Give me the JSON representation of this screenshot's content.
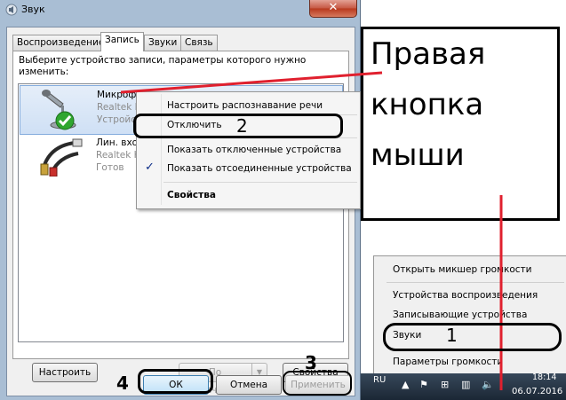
{
  "dialog": {
    "title": "Звук",
    "close_glyph": "✕",
    "tabs": [
      {
        "label": "Воспроизведение",
        "active": false
      },
      {
        "label": "Запись",
        "active": true
      },
      {
        "label": "Звуки",
        "active": false
      },
      {
        "label": "Связь",
        "active": false
      }
    ],
    "instruction": "Выберите устройство записи, параметры которого нужно изменить:",
    "devices": [
      {
        "name": "Микрофон",
        "line2": "Realtek High",
        "line3": "Устройство",
        "icon": "microphone-icon",
        "selected": true
      },
      {
        "name": "Лин. вход",
        "line2": "Realtek High",
        "line3": "Готов",
        "icon": "line-in-jack-icon",
        "selected": false
      }
    ],
    "buttons": {
      "configure": "Настроить",
      "default": "По умолчанию",
      "properties": "Свойства",
      "ok": "ОК",
      "cancel": "Отмена",
      "apply": "Применить"
    }
  },
  "context_menu": {
    "items": [
      {
        "label": "Настроить распознавание речи"
      },
      {
        "label": "Отключить"
      },
      {
        "label": "Показать отключенные устройства",
        "checked": false
      },
      {
        "label": "Показать отсоединенные устройства",
        "checked": true
      },
      {
        "label": "Свойства",
        "bold": true
      }
    ],
    "check_glyph": "✓"
  },
  "tray_menu": {
    "items": [
      "Открыть микшер громкости",
      "Устройства воспроизведения",
      "Записывающие устройства",
      "Звуки",
      "Параметры громкости"
    ]
  },
  "taskbar": {
    "language": "RU",
    "time": "18:14",
    "date": "06.07.2016"
  },
  "annotations": {
    "title_lines": [
      "Правая",
      "кнопка",
      "мыши"
    ],
    "step_1": "1",
    "step_2": "2",
    "step_3": "3",
    "step_4": "4",
    "annotation_color": "#e0202e"
  }
}
